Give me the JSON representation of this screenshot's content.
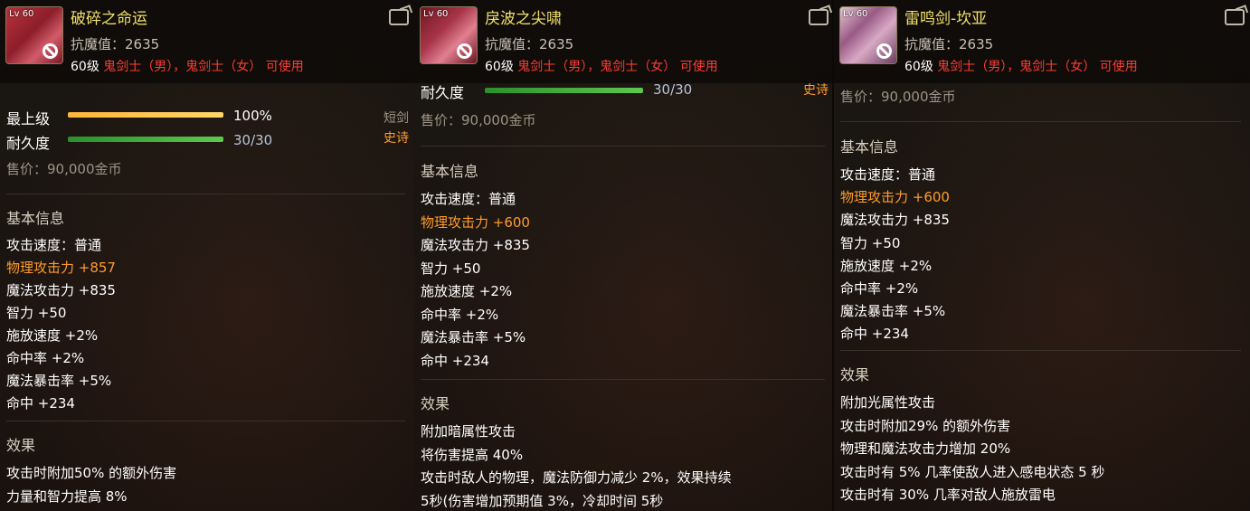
{
  "panels": [
    {
      "lv_prefix": "Lv",
      "level": "60",
      "title": "破碎之命运",
      "anti_magic": "抗魔值：2635",
      "req_level": "60级",
      "req_classes": "鬼剑士（男），鬼剑士（女）",
      "req_suffix": "可使用",
      "grade_label": "最上级",
      "grade_value": "100%",
      "grade_fill": 1.0,
      "durability_label": "耐久度",
      "durability_value": "30/30",
      "durability_fill": 1.0,
      "weapon_type": "短剑",
      "rarity": "史诗",
      "price": "售价：90,000金币",
      "basic_title": "基本信息",
      "basic": [
        {
          "text": "攻击速度：普通",
          "hl": false
        },
        {
          "text": "物理攻击力 +857",
          "hl": true
        },
        {
          "text": "魔法攻击力 +835",
          "hl": false
        },
        {
          "text": "智力 +50",
          "hl": false
        },
        {
          "text": "施放速度 +2%",
          "hl": false
        },
        {
          "text": "命中率 +2%",
          "hl": false
        },
        {
          "text": "魔法暴击率 +5%",
          "hl": false
        },
        {
          "text": "命中 +234",
          "hl": false
        }
      ],
      "effect_title": "效果",
      "effects": [
        "攻击时附加50% 的额外伤害",
        "力量和智力提高 8%"
      ]
    },
    {
      "lv_prefix": "Lv",
      "level": "60",
      "title": "戾波之尖啸",
      "anti_magic": "抗魔值：2635",
      "req_level": "60级",
      "req_classes": "鬼剑士（男），鬼剑士（女）",
      "req_suffix": "可使用",
      "durability_label": "耐久度",
      "durability_value": "30/30",
      "durability_fill": 1.0,
      "rarity": "史诗",
      "price": "售价：90,000金币",
      "basic_title": "基本信息",
      "basic": [
        {
          "text": "攻击速度：普通",
          "hl": false
        },
        {
          "text": "物理攻击力 +600",
          "hl": true
        },
        {
          "text": "魔法攻击力 +835",
          "hl": false
        },
        {
          "text": "智力 +50",
          "hl": false
        },
        {
          "text": "施放速度 +2%",
          "hl": false
        },
        {
          "text": "命中率 +2%",
          "hl": false
        },
        {
          "text": "魔法暴击率 +5%",
          "hl": false
        },
        {
          "text": "命中 +234",
          "hl": false
        }
      ],
      "effect_title": "效果",
      "effects": [
        "附加暗属性攻击",
        "将伤害提高 40%",
        "攻击时敌人的物理，魔法防御力减少 2%，效果持续",
        "5秒(伤害增加预期值 3%，冷却时间 5秒"
      ]
    },
    {
      "lv_prefix": "Lv",
      "level": "60",
      "title": "雷鸣剑-坎亚",
      "anti_magic": "抗魔值：2635",
      "req_level": "60级",
      "req_classes": "鬼剑士（男），鬼剑士（女）",
      "req_suffix": "可使用",
      "price": "售价：90,000金币",
      "basic_title": "基本信息",
      "basic": [
        {
          "text": "攻击速度：普通",
          "hl": false
        },
        {
          "text": "物理攻击力 +600",
          "hl": true
        },
        {
          "text": "魔法攻击力 +835",
          "hl": false
        },
        {
          "text": "智力 +50",
          "hl": false
        },
        {
          "text": "施放速度 +2%",
          "hl": false
        },
        {
          "text": "命中率 +2%",
          "hl": false
        },
        {
          "text": "魔法暴击率 +5%",
          "hl": false
        },
        {
          "text": "命中 +234",
          "hl": false
        }
      ],
      "effect_title": "效果",
      "effects": [
        "附加光属性攻击",
        "攻击时附加29% 的额外伤害",
        "物理和魔法攻击力增加 20%",
        "攻击时有 5% 几率使敌人进入感电状态 5 秒",
        "攻击时有 30% 几率对敌人施放雷电"
      ]
    }
  ]
}
